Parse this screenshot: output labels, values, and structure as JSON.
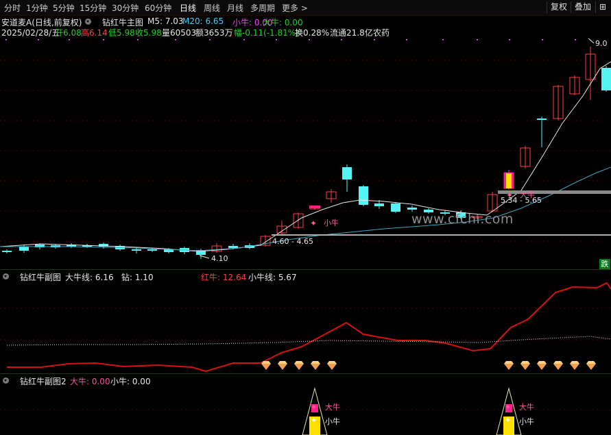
{
  "toolbar": {
    "periods": [
      "分时",
      "1分钟",
      "5分钟",
      "15分钟",
      "30分钟",
      "60分钟",
      "日线",
      "周线",
      "月线",
      "多周期",
      "更多 >"
    ],
    "active_period": "日线",
    "right_buttons": [
      "复权",
      "叠加",
      "⊞"
    ]
  },
  "stock": {
    "name_line": "安道麦A(日线,前复权)",
    "indicator_name": "钻红牛主图",
    "ma5": "M5: 7.03",
    "ma20": "M20: 6.65",
    "small_bull": "小牛: 0.00",
    "big_bull": "大牛: 0.00"
  },
  "quote": {
    "date": "2025/02/28/五",
    "open": "开6.08",
    "high": "高6.14",
    "low": "低5.98",
    "close": "收5.98",
    "volume": "量60503",
    "amount": "额3653万",
    "change": "幅-0.11(-1.81%)",
    "turnover": "换0.28%",
    "float": "流通21.8亿",
    "sector": "农药"
  },
  "main_chart": {
    "price_high_label": "9.0",
    "price_low_label": "4.10",
    "range_label_1": "4.60 - 4.65",
    "range_label_2": "5.34 - 5.65",
    "small_bull_mark": "小牛",
    "big_bull_mark": "大牛",
    "fall_badge": "跌",
    "watermark": "www.cfchi.com"
  },
  "sub1": {
    "title": "钻红牛副图",
    "big_bull_line": "大牛线: 6.16",
    "drill": "钻: 1.10",
    "red_bull": "红牛: 12.64",
    "small_bull_line": "小牛线: 5.67"
  },
  "sub2": {
    "title": "钻红牛副图2",
    "big_bull": "大牛: 0.00",
    "small_bull": "小牛: 0.00",
    "big_bull_mark": "大牛",
    "small_bull_mark": "小牛"
  },
  "colors": {
    "up": "#ff4040",
    "down": "#54f4f4",
    "red_line": "#d81010",
    "ma_line": "#e8e8e8",
    "ma20_line": "#3aa8c8",
    "background": "#000000"
  }
}
